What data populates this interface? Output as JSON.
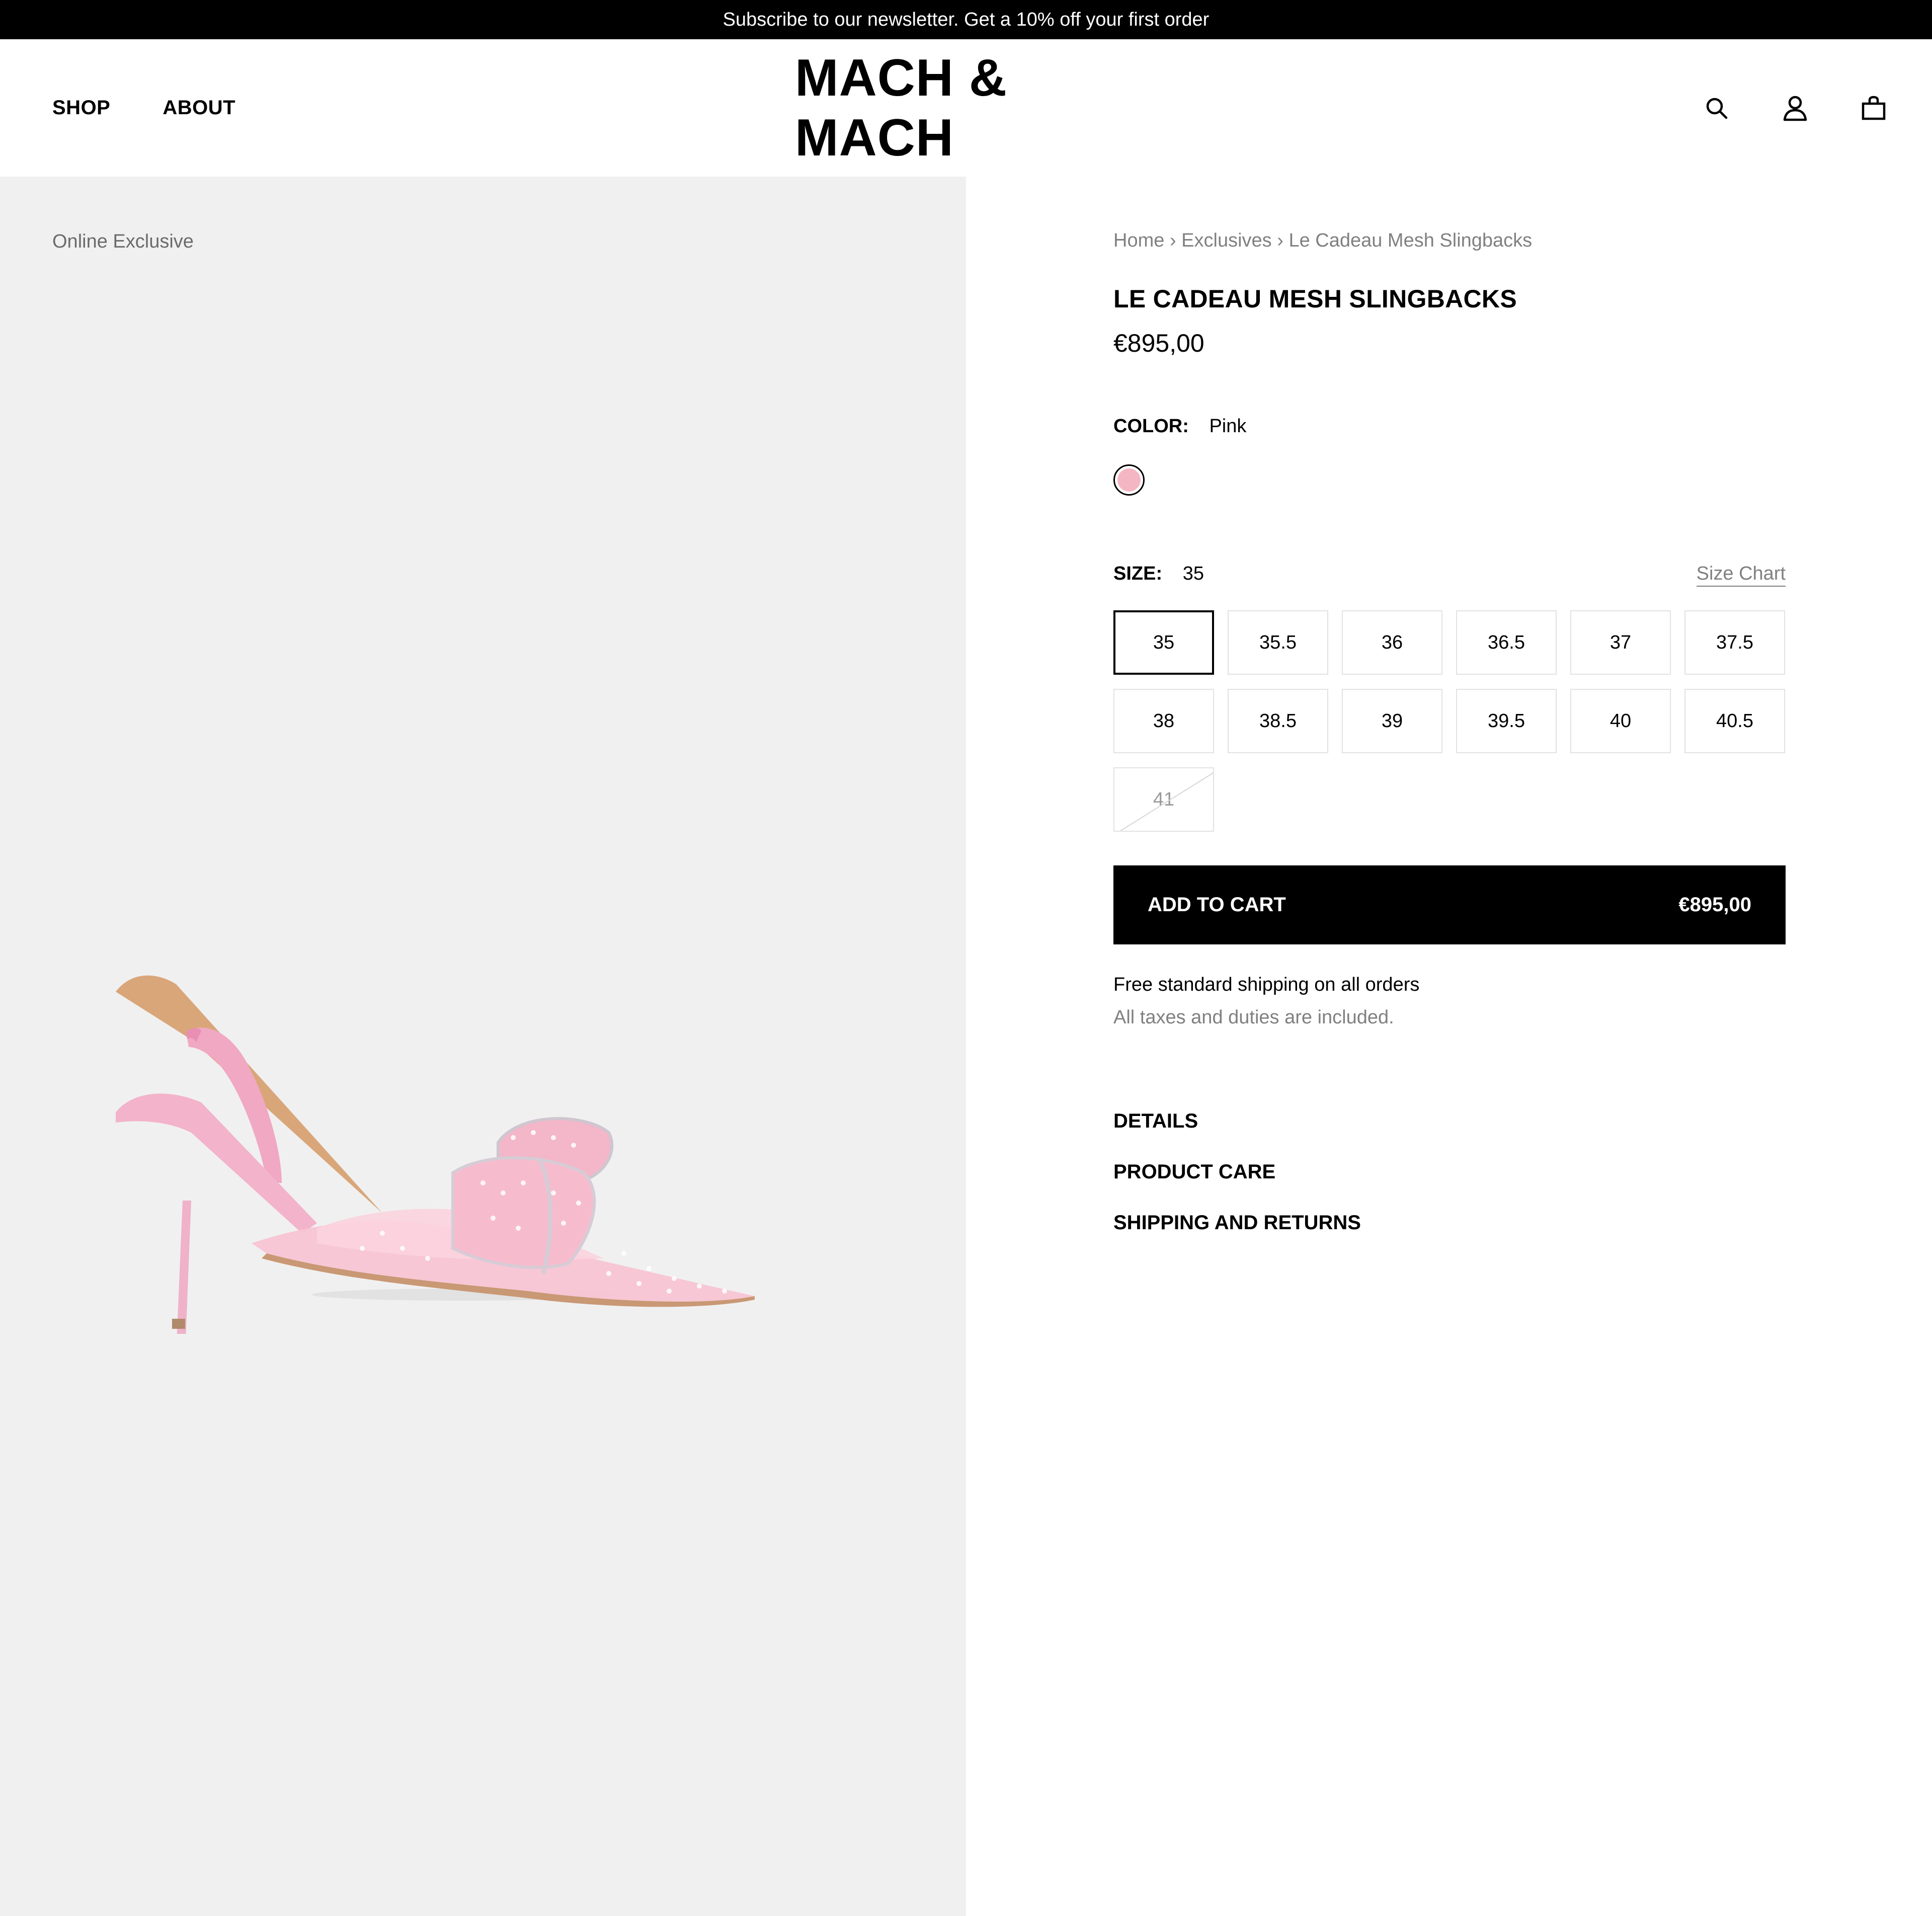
{
  "announcement": "Subscribe to our newsletter. Get a 10% off your first order",
  "nav": {
    "shop": "SHOP",
    "about": "ABOUT"
  },
  "logo": "MACH & MACH",
  "header_icons": [
    "search-icon",
    "account-icon",
    "cart-icon"
  ],
  "gallery": {
    "badge": "Online Exclusive"
  },
  "breadcrumb": {
    "home": "Home",
    "sep": "›",
    "category": "Exclusives",
    "current": "Le Cadeau Mesh Slingbacks"
  },
  "product": {
    "title": "LE CADEAU MESH SLINGBACKS",
    "price": "€895,00",
    "color_label": "COLOR:",
    "color_value": "Pink",
    "swatch_color": "#f5b6c4",
    "size_label": "SIZE:",
    "size_value": "35",
    "size_chart": "Size Chart",
    "sizes": [
      "35",
      "35.5",
      "36",
      "36.5",
      "37",
      "37.5",
      "38",
      "38.5",
      "39",
      "39.5",
      "40",
      "40.5",
      "41"
    ],
    "selected_size": "35",
    "unavailable_sizes": [
      "41"
    ],
    "add_to_cart": "ADD TO CART",
    "add_to_cart_price": "€895,00",
    "shipping": "Free standard shipping on all orders",
    "taxes": "All taxes and duties are included."
  },
  "accordion": {
    "details": "DETAILS",
    "care": "PRODUCT CARE",
    "shipping": "SHIPPING AND RETURNS"
  }
}
